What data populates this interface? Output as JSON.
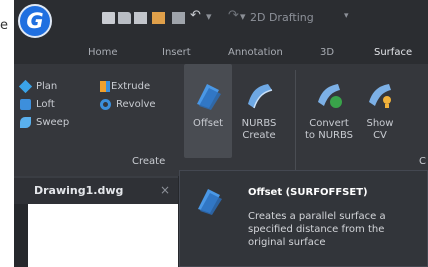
{
  "corner_glyph": "e",
  "quick_access": {
    "app_logo_letter": "G",
    "undo_glyph": "↶",
    "redo_glyph": "↷",
    "separator_glyph": "▾",
    "workspace": "2D Drafting",
    "dropdown_glyph": "▾"
  },
  "ribbon_tabs": [
    "Home",
    "Insert",
    "Annotation",
    "3D",
    "Surface"
  ],
  "active_tab": "Surface",
  "create_group": {
    "label": "Create",
    "small_buttons": [
      {
        "label": "Plan",
        "icon": "plan-surface-icon"
      },
      {
        "label": "Loft",
        "icon": "loft-surface-icon"
      },
      {
        "label": "Sweep",
        "icon": "sweep-surface-icon"
      },
      {
        "label": "Extrude",
        "icon": "extrude-surface-icon"
      },
      {
        "label": "Revolve",
        "icon": "revolve-surface-icon"
      }
    ],
    "large_buttons": [
      {
        "label": "Offset",
        "icon": "offset-surface-icon"
      },
      {
        "label": "NURBS\nCreate",
        "icon": "nurbs-create-icon"
      }
    ]
  },
  "edit_group": {
    "label": "C",
    "large_buttons": [
      {
        "label": "Convert\nto NURBS",
        "icon": "convert-to-nurbs-icon"
      },
      {
        "label": "Show\nCV",
        "icon": "show-cv-icon"
      }
    ]
  },
  "document_tab": {
    "label": "Drawing1.dwg",
    "close_glyph": "×"
  },
  "tooltip": {
    "title": "Offset (SURFOFFSET)",
    "description": "Creates a parallel surface a specified distance from the original surface"
  },
  "colors": {
    "accent_blue": "#1f6fe0",
    "ribbon_bg": "#35373c",
    "surface_icon_blue": "#3d8fdc",
    "surface_icon_orange": "#f0a02c",
    "nurbs_green": "#39a34a"
  }
}
